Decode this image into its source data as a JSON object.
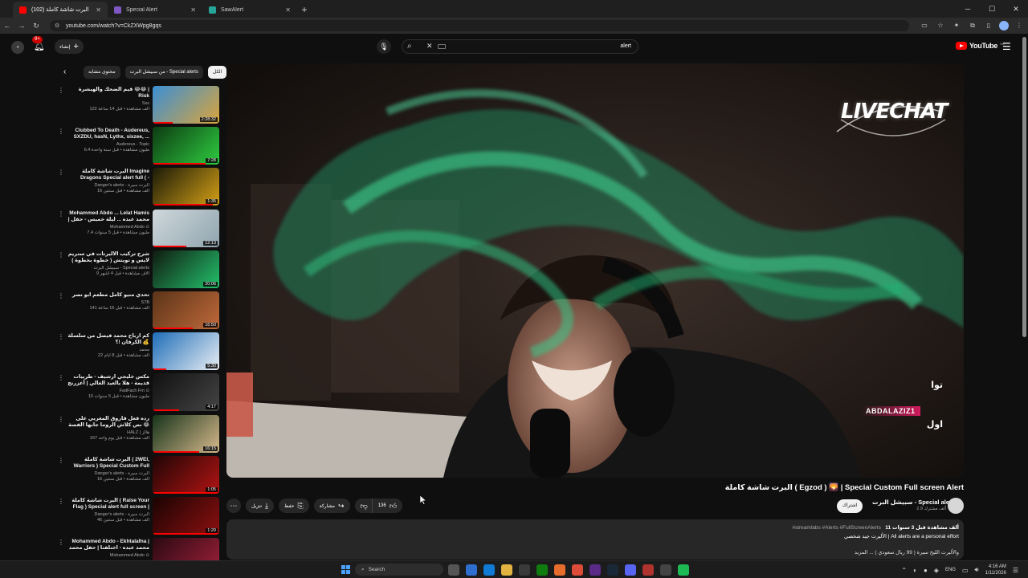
{
  "browser": {
    "tabs": [
      {
        "title": "(102) البرت شاشة كاملة",
        "active": true,
        "favicon_color": "#ff0000"
      },
      {
        "title": "Special Alert",
        "active": false,
        "favicon_color": "#7e57c2"
      },
      {
        "title": "SawAlert",
        "active": false,
        "favicon_color": "#26a69a"
      }
    ],
    "new_tab": "+",
    "url": "youtube.com/watch?v=CkZXWpg8gqs"
  },
  "header": {
    "notifications_count": "9+",
    "create_label": "إنشاء",
    "search_query": "alert",
    "logo_text": "YouTube",
    "logo_country": "SA"
  },
  "chips": {
    "items": [
      {
        "label": "الكل",
        "active": true
      },
      {
        "label": "من سبيشل البرت - Special alerts",
        "active": false
      },
      {
        "label": "محتوى مشابه",
        "active": false
      }
    ]
  },
  "related": [
    {
      "title": "قيم الضحك والهيشرة 😂😂 | Risk",
      "channel": "Sxs",
      "views": "122 ألف مشاهدة • قبل 14 ساعة",
      "duration": "2:28:32",
      "progress": 0.3,
      "colors": [
        "#3b8fd4",
        "#d9a43c"
      ]
    },
    {
      "title": "Clubbed To Death - Audereus, SXZDU, hasN, Lythx, sixzee, ...",
      "channel": "Audereus - Topic",
      "views": "6.4 مليون مشاهدة • قبل سنة واحدة",
      "duration": "7:28",
      "progress": 0.8,
      "colors": [
        "#0d3b12",
        "#2ecc40"
      ]
    },
    {
      "title": "البرت شاشة كاملة Imagine Dragons Special alert full ( - Natural",
      "channel": "Danger's alerts - البرت سيرة",
      "views": "16 ألف مشاهدة • قبل سنتين",
      "duration": "1:35",
      "progress": 0.9,
      "colors": [
        "#1a1a08",
        "#d4a017"
      ]
    },
    {
      "title": "Mohammed Abdo ... Lelat Hamis | محمد عبده ... ليلة خميس - حفل",
      "channel": "Mohammed Abdo ⊙",
      "views": "7.4 مليون مشاهدة • قبل 5 سنوات",
      "duration": "12:13",
      "progress": 0.5,
      "colors": [
        "#cfd8dc",
        "#90a4ae"
      ]
    },
    {
      "title": "شرح تركيب الأليرتات في ستريم لايس و تويتش ( خطوة بخطوة )",
      "channel": "سبيشل البرت - Special alerts",
      "views": "9 آلاف مشاهدة • قبل 4 أشهر",
      "duration": "20:06",
      "progress": 0.0,
      "colors": [
        "#101a10",
        "#23c16b"
      ]
    },
    {
      "title": "تحدي منيو كامل مطعم ابو نصر",
      "channel": "S7B",
      "views": "141 ألف مشاهدة • قبل 16 ساعة",
      "duration": "16:50",
      "progress": 0.6,
      "colors": [
        "#5a3418",
        "#c0693a"
      ]
    },
    {
      "title": "كم ارباح محمد فيصل من سلسلة الكرفان !؟ 💰",
      "channel": "محمد",
      "views": "22 ألف مشاهدة • قبل 8 أيام",
      "duration": "5:30",
      "progress": 0.2,
      "colors": [
        "#1e6db8",
        "#e9eef2"
      ]
    },
    {
      "title": "مكس خليجي ارشيف - طربيات قديمة - هلا بالعيد الغالي | أعزرنج جديد",
      "channel": "FadFach Fm ⊙",
      "views": "10 مليون مشاهدة • قبل 5 سنوات",
      "duration": "4:17",
      "progress": 0.4,
      "colors": [
        "#111",
        "#444"
      ]
    },
    {
      "title": "رده فعل فاروق المغربي على نص كلاش الروما جابها القصة 😂",
      "channel": "HALZ | هالز",
      "views": "167 ألف مشاهدة • قبل يوم واحد",
      "duration": "16:15",
      "progress": 0.7,
      "colors": [
        "#16331a",
        "#d7b98c"
      ]
    },
    {
      "title": "البرت شاشة كاملة ( 2WEI, Warriors ) Special Custom Full screen",
      "channel": "Danger's alerts - البرت سيرة",
      "views": "16 ألف مشاهدة • قبل سنتين",
      "duration": "1:05",
      "progress": 1.0,
      "colors": [
        "#200505",
        "#b21414"
      ]
    },
    {
      "title": "البرت شاشة كاملة ( Raise Your Flag ) Special alert full screen |",
      "channel": "Danger's alerts - البرت سيرة",
      "views": "46 ألف مشاهدة • قبل سنتين",
      "duration": "1:20",
      "progress": 1.0,
      "colors": [
        "#1a0303",
        "#8c1010"
      ]
    },
    {
      "title": "Mohammed Abdo - Ekhtalafna | محمد عبده - اختلفنا | حفل محمد عبده",
      "channel": "Mohammed Abdo ⊙",
      "views": "",
      "duration": "",
      "progress": 0.0,
      "colors": [
        "#2a0a12",
        "#a0203a"
      ]
    }
  ],
  "player": {
    "overlay_logo": "LIVECHAT",
    "chat": [
      {
        "name": "",
        "message": "توا"
      },
      {
        "name": "ABDALAZIZ1",
        "message": "اول"
      }
    ]
  },
  "video": {
    "title": "البرت شاشة كاملة ( Egzod ) 🌄 | Special Custom Full screen Alert",
    "channel_name": "سبيشل البرت - Special alerts",
    "channel_subs": "2.9 ألف مشترك",
    "subscribe_label": "اشتراك",
    "likes": "136",
    "share_label": "مشاركة",
    "save_label": "حفظ",
    "download_label": "تنزيل",
    "description_stats": "11 ألف مشاهدة  قبل 3 سنوات",
    "description_tags": "#streamlabs #Alerts #FullScreenAlerts",
    "description_line2": "الأليرت جيد شخصي | All alerts are a personal effort",
    "description_line3": "والأليرت الليح سيرة ( 99 ريال سعودي ) ... المزيد"
  },
  "taskbar": {
    "search_label": "Search",
    "lang": "ENG",
    "time": "4:16 AM",
    "date": "1/11/2026"
  }
}
